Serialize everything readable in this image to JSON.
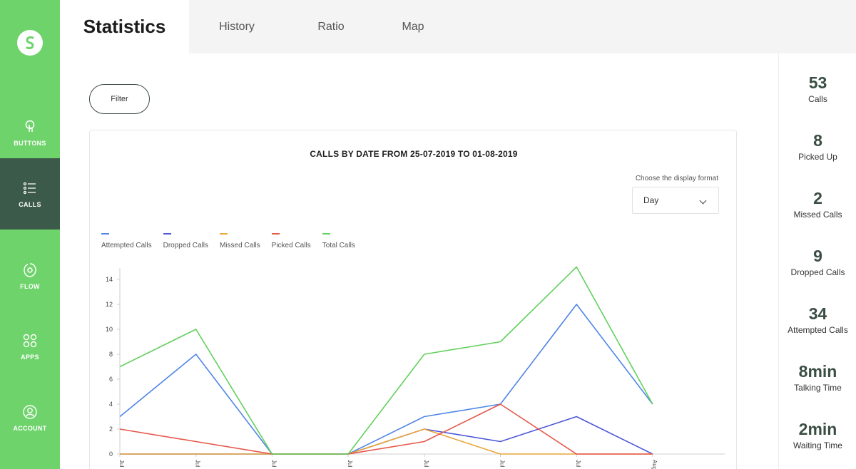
{
  "sidebar": {
    "items": [
      {
        "label": "BUTTONS",
        "icon": "touch-icon"
      },
      {
        "label": "CALLS",
        "icon": "list-icon",
        "active": true
      },
      {
        "label": "FLOW",
        "icon": "flow-icon"
      },
      {
        "label": "APPS",
        "icon": "apps-icon"
      },
      {
        "label": "ACCOUNT",
        "icon": "account-icon"
      }
    ]
  },
  "tabs": [
    "Statistics",
    "History",
    "Ratio",
    "Map"
  ],
  "filter_label": "Filter",
  "chart_card": {
    "format_label": "Choose the display format",
    "format_value": "Day"
  },
  "chart_data": {
    "type": "line",
    "title": "CALLS BY DATE FROM 25-07-2019 TO 01-08-2019",
    "x": [
      "Jul",
      "Jul",
      "Jul",
      "Jul",
      "Jul",
      "Jul",
      "Jul",
      "Aug"
    ],
    "ylim": [
      0,
      14
    ],
    "yticks": [
      0,
      2,
      4,
      6,
      8,
      10,
      12,
      14
    ],
    "xlabel": "",
    "ylabel": "",
    "legend": "top-left",
    "grid": false,
    "series": [
      {
        "name": "Attempted Calls",
        "color": "#4f86e6",
        "values": [
          3,
          8,
          0,
          0,
          3,
          4,
          12,
          4
        ]
      },
      {
        "name": "Dropped Calls",
        "color": "#4b57d6",
        "values": [
          0,
          0,
          0,
          0,
          2,
          1,
          3,
          0
        ]
      },
      {
        "name": "Missed Calls",
        "color": "#e9a63a",
        "values": [
          0,
          0,
          0,
          0,
          2,
          0,
          0,
          0
        ]
      },
      {
        "name": "Picked Calls",
        "color": "#e5574a",
        "values": [
          2,
          1,
          0,
          0,
          1,
          4,
          0,
          0
        ]
      },
      {
        "name": "Total Calls",
        "color": "#62d05c",
        "values": [
          7,
          10,
          0,
          0,
          8,
          9,
          15,
          4
        ]
      }
    ]
  },
  "stats": [
    {
      "value": "53",
      "label": "Calls"
    },
    {
      "value": "8",
      "label": "Picked Up"
    },
    {
      "value": "2",
      "label": "Missed Calls"
    },
    {
      "value": "9",
      "label": "Dropped Calls"
    },
    {
      "value": "34",
      "label": "Attempted Calls"
    },
    {
      "value": "8min",
      "label": "Talking Time"
    },
    {
      "value": "2min",
      "label": "Waiting Time"
    }
  ]
}
